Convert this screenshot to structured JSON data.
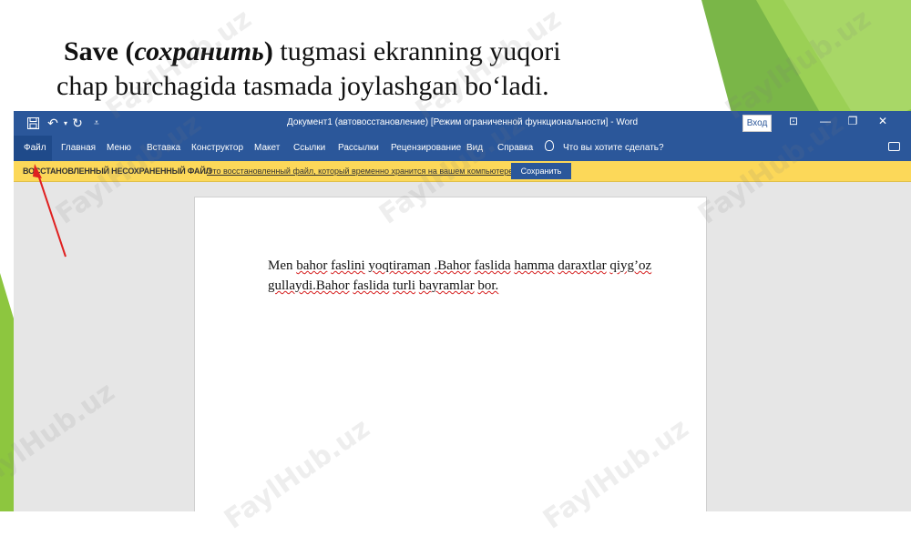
{
  "slide": {
    "title_line1_bold": "Save (",
    "title_line1_italic": "сохранить",
    "title_line1_bold_end": ")",
    "title_line1_rest": " tugmasi ekranning yuqori",
    "title_line2": "chap burchagida tasmada joylashgan bo‘ladi."
  },
  "word": {
    "window_title": "Документ1 (автовосстановление) [Режим ограниченной функциональности]  -  Word",
    "signin_label": "Вход",
    "quick_access": {
      "save_icon": "save-icon",
      "undo_icon": "undo-icon",
      "redo_icon": "redo-icon",
      "customize_icon": "customize-icon"
    },
    "menu": [
      "Файл",
      "Главная",
      "Меню",
      "Вставка",
      "Конструктор",
      "Макет",
      "Ссылки",
      "Рассылки",
      "Рецензирование",
      "Вид",
      "Справка"
    ],
    "tell_me": "Что вы хотите сделать?",
    "infobar": {
      "title": "ВОССТАНОВЛЕННЫЙ НЕСОХРАНЕННЫЙ ФАЙЛ",
      "text": "Это восстановленный файл, который временно хранится на вашем компьютере.",
      "button": "Сохранить"
    },
    "document_lines": [
      "Men bahor faslini yoqtiraman .Bahor faslida hamma daraxtlar qiyg’oz",
      "gullaydi.Bahor faslida turli bayramlar bor."
    ]
  },
  "watermark": "FaylHub.uz",
  "colors": {
    "ribbon": "#2b579a",
    "infobar": "#fcd859",
    "green_deco": "#8dc63f",
    "arrow": "#e02020"
  }
}
